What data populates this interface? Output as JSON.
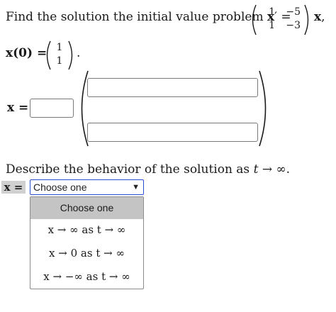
{
  "problem": {
    "intro": "Find the solution the initial value problem",
    "lhs_vec": "x",
    "prime_eq": "′ =",
    "matrix": [
      [
        "1",
        "−5"
      ],
      [
        "1",
        "−3"
      ]
    ],
    "rhs_vec": "x",
    "comma": ",",
    "initial_lhs": "x(0) =",
    "initial_vec": [
      "1",
      "1"
    ],
    "period": "."
  },
  "answer": {
    "lhs": "x ="
  },
  "question2": {
    "text_before": "Describe the behavior of the solution as",
    "var": "t",
    "text_after": "→ ∞."
  },
  "select": {
    "badge": "x =",
    "value": "Choose one",
    "arrow": "▼"
  },
  "dropdown": {
    "header": "Choose one",
    "options": [
      "x → ∞ as t → ∞",
      "x → 0 as t → ∞",
      "x → −∞ as t → ∞"
    ]
  }
}
